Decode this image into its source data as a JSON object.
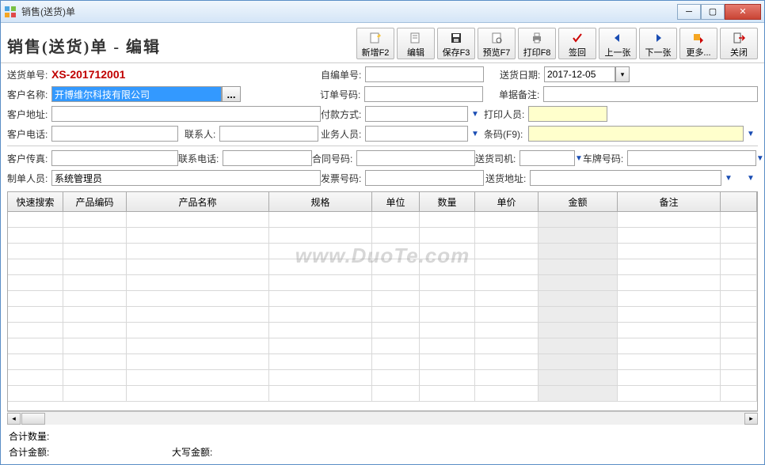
{
  "window": {
    "title": "销售(送货)单"
  },
  "page": {
    "title": "销售(送货)单 - 编辑"
  },
  "toolbar": {
    "new": "新增F2",
    "edit": "编辑",
    "save": "保存F3",
    "preview": "预览F7",
    "print": "打印F8",
    "sign": "签回",
    "prev": "上一张",
    "next": "下一张",
    "more": "更多...",
    "close": "关闭"
  },
  "form": {
    "order_no_lbl": "送货单号:",
    "order_no": "XS-201712001",
    "self_no_lbl": "自编单号:",
    "self_no": "",
    "date_lbl": "送货日期:",
    "date": "2017-12-05",
    "customer_lbl": "客户名称:",
    "customer": "开博维尔科技有限公司",
    "order_code_lbl": "订单号码:",
    "order_code": "",
    "remark_lbl": "单据备注:",
    "remark": "",
    "addr_lbl": "客户地址:",
    "addr": "",
    "pay_lbl": "付款方式:",
    "pay": "",
    "printer_lbl": "打印人员:",
    "printer": "",
    "phone_lbl": "客户电话:",
    "phone": "",
    "contact_lbl": "联系人:",
    "contact": "",
    "staff_lbl": "业务人员:",
    "staff": "",
    "barcode_lbl": "条码(F9):",
    "barcode": "",
    "fax_lbl": "客户传真:",
    "fax": "",
    "contact_phone_lbl": "联系电话:",
    "contact_phone": "",
    "contract_lbl": "合同号码:",
    "contract": "",
    "driver_lbl": "送货司机:",
    "driver": "",
    "plate_lbl": "车牌号码:",
    "plate": "",
    "creator_lbl": "制单人员:",
    "creator": "系统管理员",
    "invoice_lbl": "发票号码:",
    "invoice": "",
    "ship_addr_lbl": "送货地址:",
    "ship_addr": ""
  },
  "grid": {
    "headers": [
      "快速搜索",
      "产品编码",
      "产品名称",
      "规格",
      "单位",
      "数量",
      "单价",
      "金额",
      "备注"
    ],
    "widths": [
      70,
      80,
      180,
      130,
      60,
      70,
      80,
      100,
      130
    ],
    "rows": 12
  },
  "footer": {
    "qty_lbl": "合计数量:",
    "qty": "",
    "amt_lbl": "合计金额:",
    "amt": "",
    "cn_amt_lbl": "大写金额:",
    "cn_amt": ""
  },
  "watermark": "www.DuoTe.com"
}
